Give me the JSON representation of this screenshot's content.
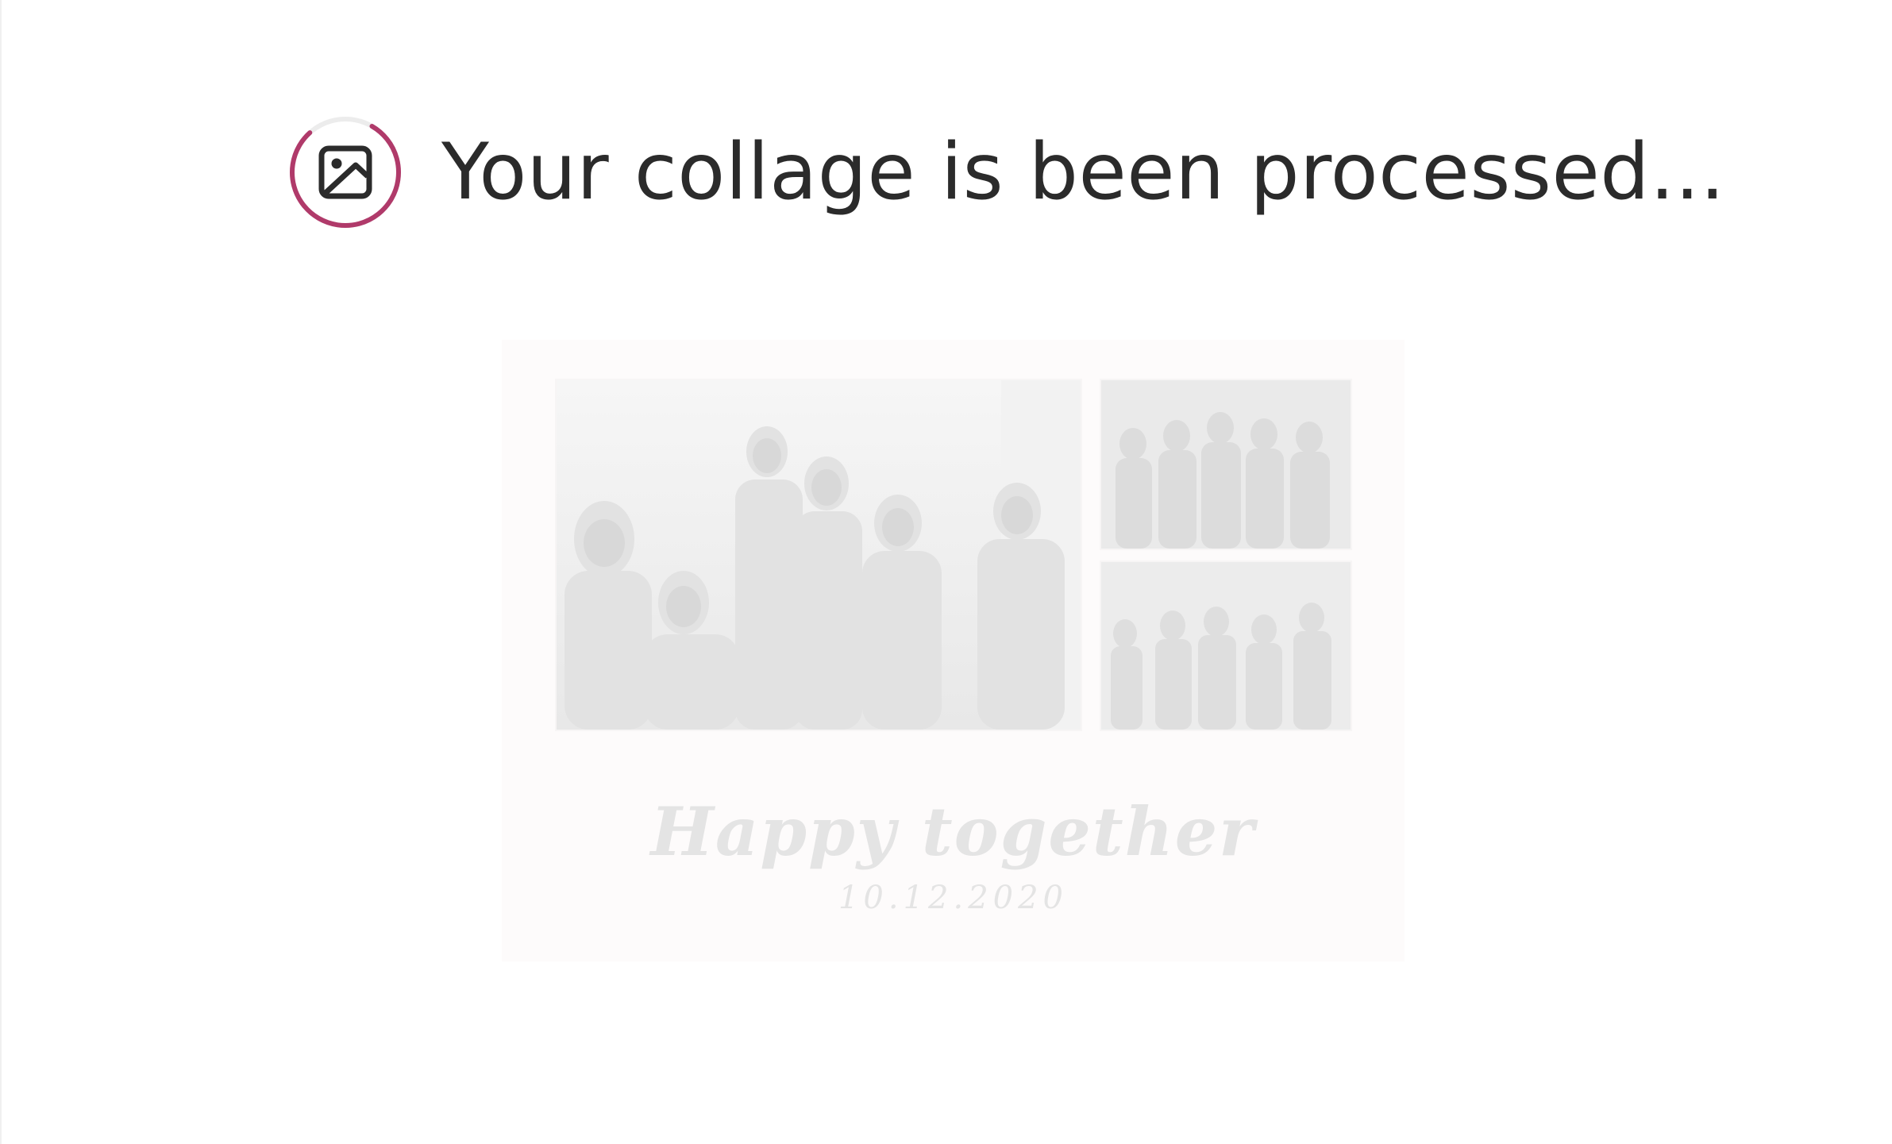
{
  "status": {
    "title": "Your collage is been processed...",
    "icon": "image-icon",
    "accent_color": "#b03a6a",
    "progress": 0.8
  },
  "collage": {
    "caption_title": "Happy together",
    "caption_date": "10.12.2020",
    "photos": [
      {
        "name": "party-group-photo-main"
      },
      {
        "name": "group-photo-top-right"
      },
      {
        "name": "group-photo-bottom-right"
      }
    ]
  }
}
